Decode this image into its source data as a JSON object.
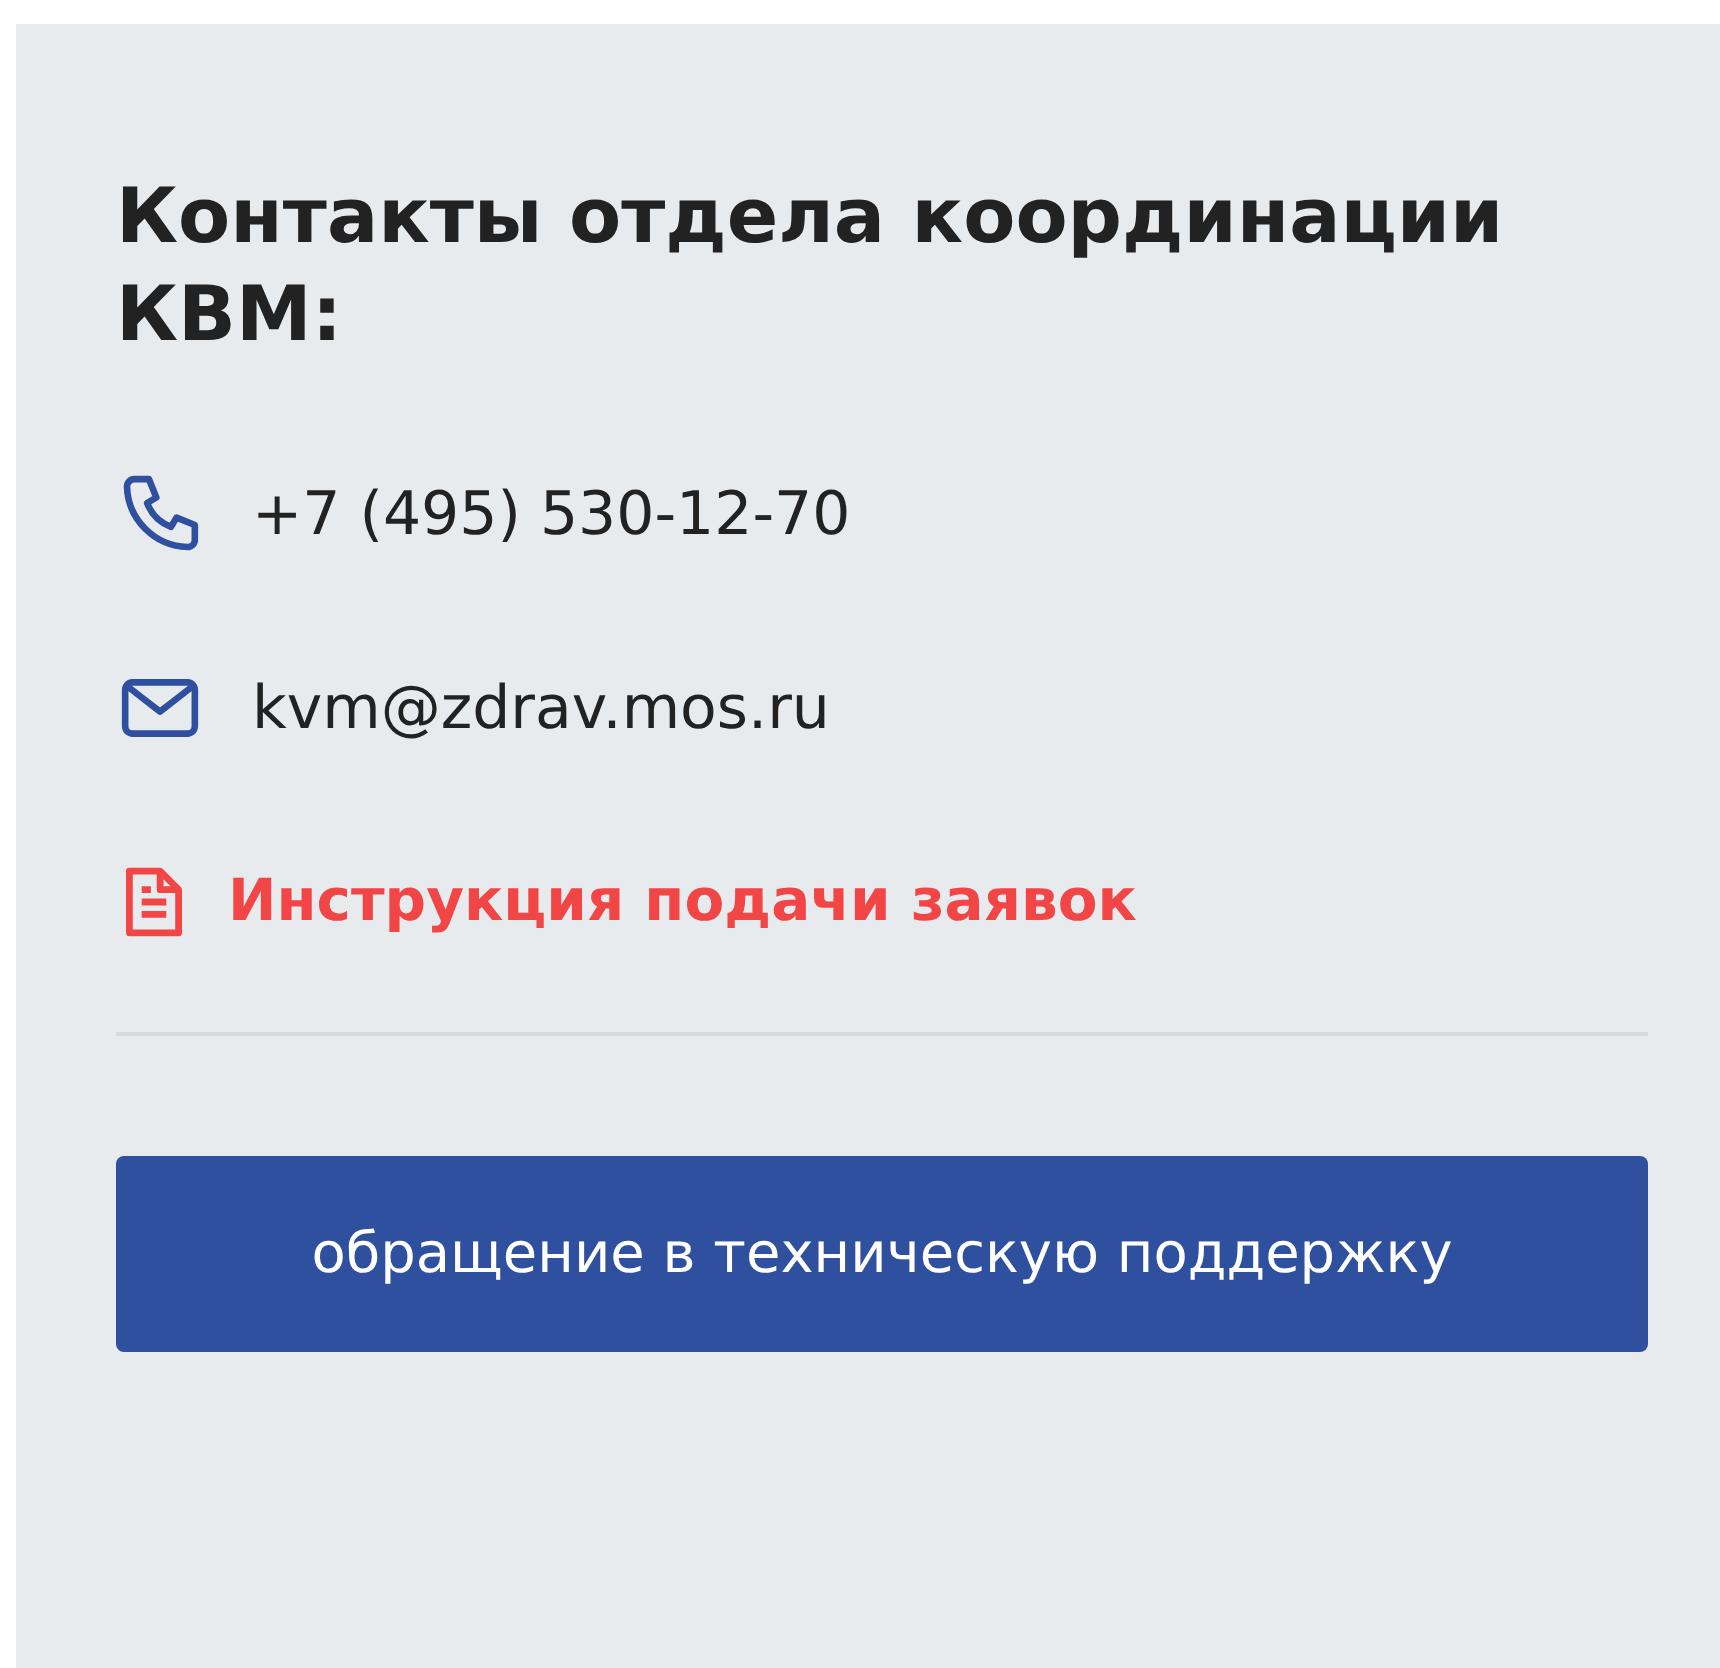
{
  "title": "Контакты отдела координации КВМ:",
  "contacts": [
    {
      "kind": "phone",
      "text": "+7 (495) 530-12-70"
    },
    {
      "kind": "email",
      "text": "kvm@zdrav.mos.ru"
    }
  ],
  "instruction_link": "Инструкция подачи заявок",
  "support_button": "обращение в техническую поддержку"
}
